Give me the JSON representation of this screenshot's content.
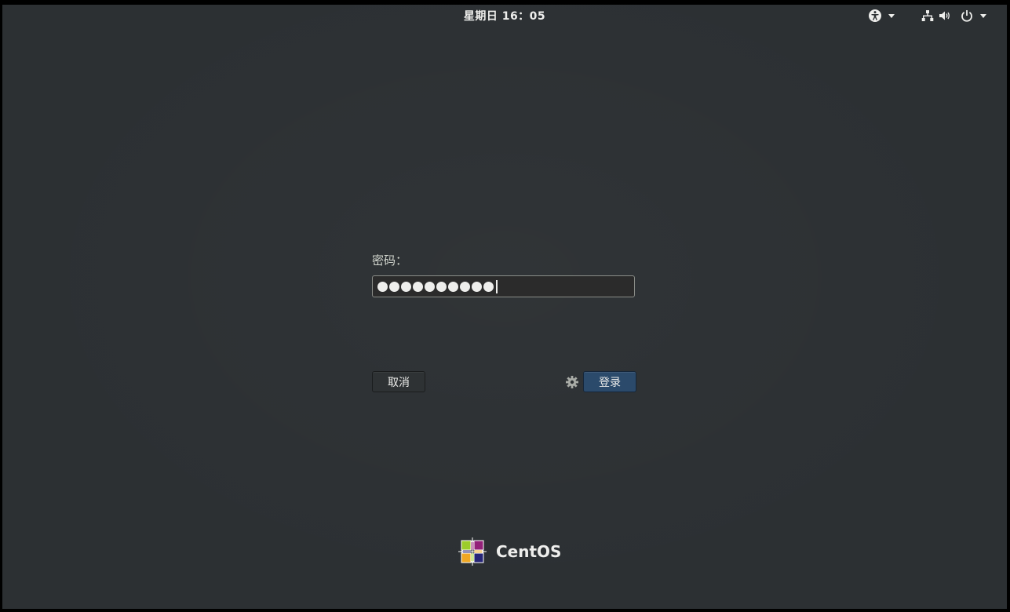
{
  "topbar": {
    "clock": "星期日 16：05",
    "icons": [
      "accessibility-icon",
      "network-wired-icon",
      "volume-icon",
      "power-icon"
    ]
  },
  "login": {
    "password_label": "密码：",
    "password_masked_length": 10,
    "cancel_label": "取消",
    "login_label": "登录"
  },
  "brand": {
    "name": "CentOS"
  },
  "colors": {
    "background": "#2c3033",
    "login_button": "#2b4a6b",
    "text": "#eeeeec"
  }
}
